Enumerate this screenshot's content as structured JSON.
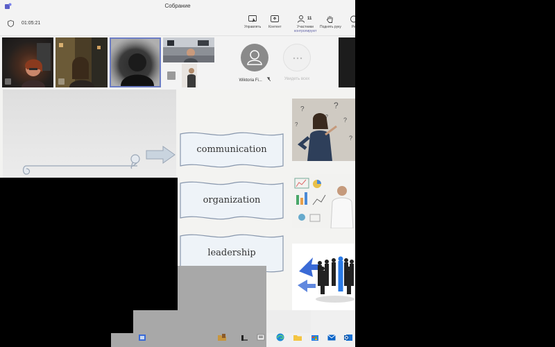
{
  "window": {
    "title": "Собрание"
  },
  "meeting": {
    "elapsed": "01:05:21"
  },
  "toolbar": {
    "manage_label": "Управлять",
    "content_label": "Контент",
    "participants_label": "Участники",
    "participants_count": "11",
    "participants_sub": "контролируют",
    "raise_hand_label": "Поднять руку",
    "more_label": "Ре"
  },
  "participants": {
    "named_tile": "Wiktoria Fi...",
    "view_all": "Увидеть всех"
  },
  "slide": {
    "banners": [
      "communication",
      "organization",
      "leadership"
    ]
  },
  "colors": {
    "accent": "#6264a7",
    "banner_fill": "#eef3f8",
    "banner_stroke": "#8796ac",
    "arrow_fill": "#c9d4df"
  },
  "icons": {
    "taskbar": [
      "file-explorer-icon",
      "explorer-folder-icon",
      "terminal-icon",
      "edge-icon",
      "folder-icon",
      "store-icon",
      "mail-icon",
      "outlook-icon"
    ]
  }
}
